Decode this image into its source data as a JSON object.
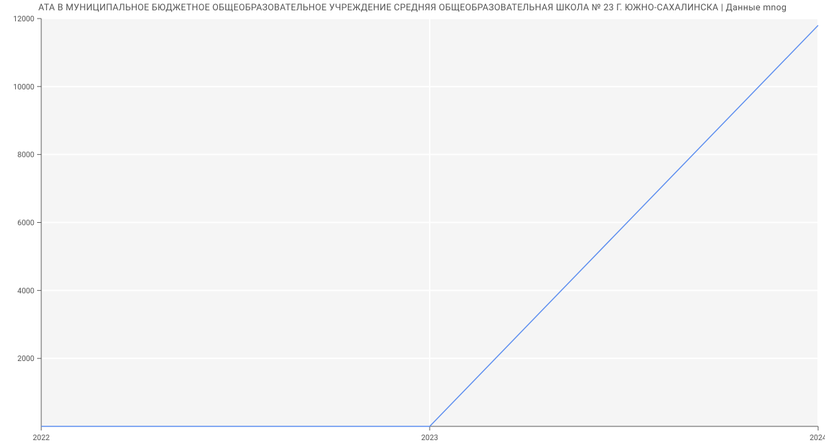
{
  "title": "АТА В МУНИЦИПАЛЬНОЕ БЮДЖЕТНОЕ ОБЩЕОБРАЗОВАТЕЛЬНОЕ УЧРЕЖДЕНИЕ СРЕДНЯЯ ОБЩЕОБРАЗОВАТЕЛЬНАЯ ШКОЛА № 23 Г. ЮЖНО-САХАЛИНСКА | Данные mnog",
  "chart_data": {
    "type": "line",
    "x": [
      2022,
      2023,
      2024
    ],
    "values": [
      0,
      0,
      11800
    ],
    "x_ticks": [
      2022,
      2023,
      2024
    ],
    "y_ticks": [
      2000,
      4000,
      6000,
      8000,
      10000,
      12000
    ],
    "xlim": [
      2022,
      2024
    ],
    "ylim": [
      0,
      12000
    ]
  }
}
